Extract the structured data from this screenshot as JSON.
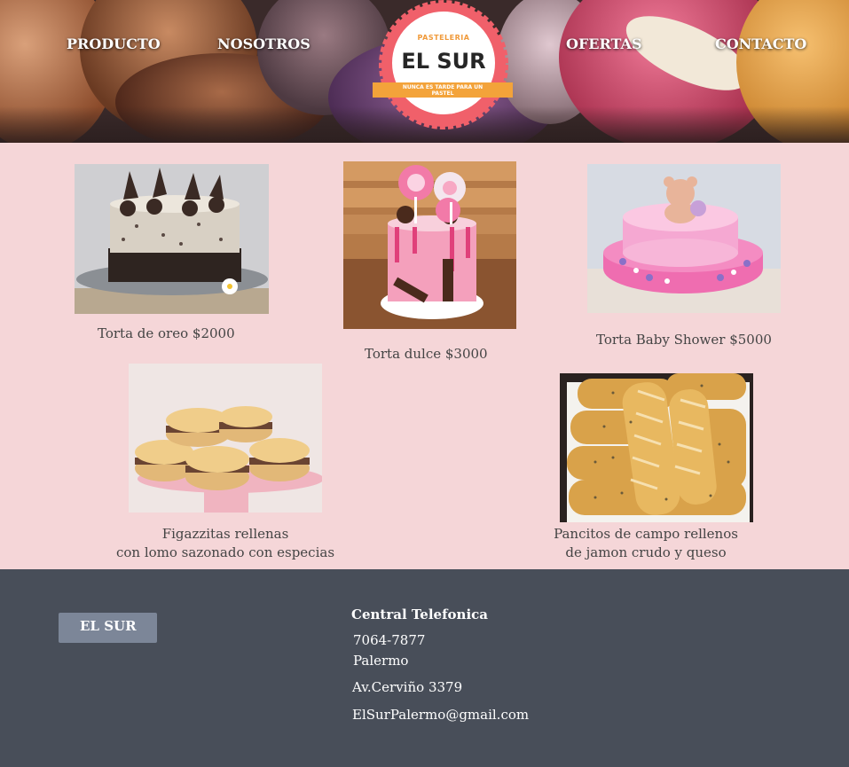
{
  "nav": {
    "items": [
      {
        "label": "PRODUCTO"
      },
      {
        "label": "NOSOTROS"
      },
      {
        "label": "OFERTAS"
      },
      {
        "label": "CONTACTO"
      }
    ]
  },
  "logo": {
    "small": "PASTELERIA",
    "title": "EL SUR",
    "tagline_1": "NUNCA ES TARDE PARA UN",
    "tagline_2": "PASTEL"
  },
  "products": [
    {
      "caption": "Torta de oreo $2000"
    },
    {
      "caption": "Torta dulce $3000"
    },
    {
      "caption": "Torta Baby Shower $5000"
    },
    {
      "caption_1": "Figazzitas rellenas",
      "caption_2": "con lomo sazonado con especias"
    },
    {
      "caption_1": "Pancitos de campo rellenos",
      "caption_2": "de jamon crudo y queso"
    }
  ],
  "footer": {
    "brand": "EL SUR",
    "phone_title": "Central Telefonica",
    "phone": "7064-7877",
    "city": "Palermo",
    "address": "Av.Cerviño 3379",
    "email": "ElSurPalermo@gmail.com"
  },
  "colors": {
    "page_bg": "#f5d6d8",
    "footer_bg": "#484e59",
    "brand_button": "#7c8698",
    "logo_red": "#f0606a",
    "logo_orange": "#f3a33a"
  }
}
